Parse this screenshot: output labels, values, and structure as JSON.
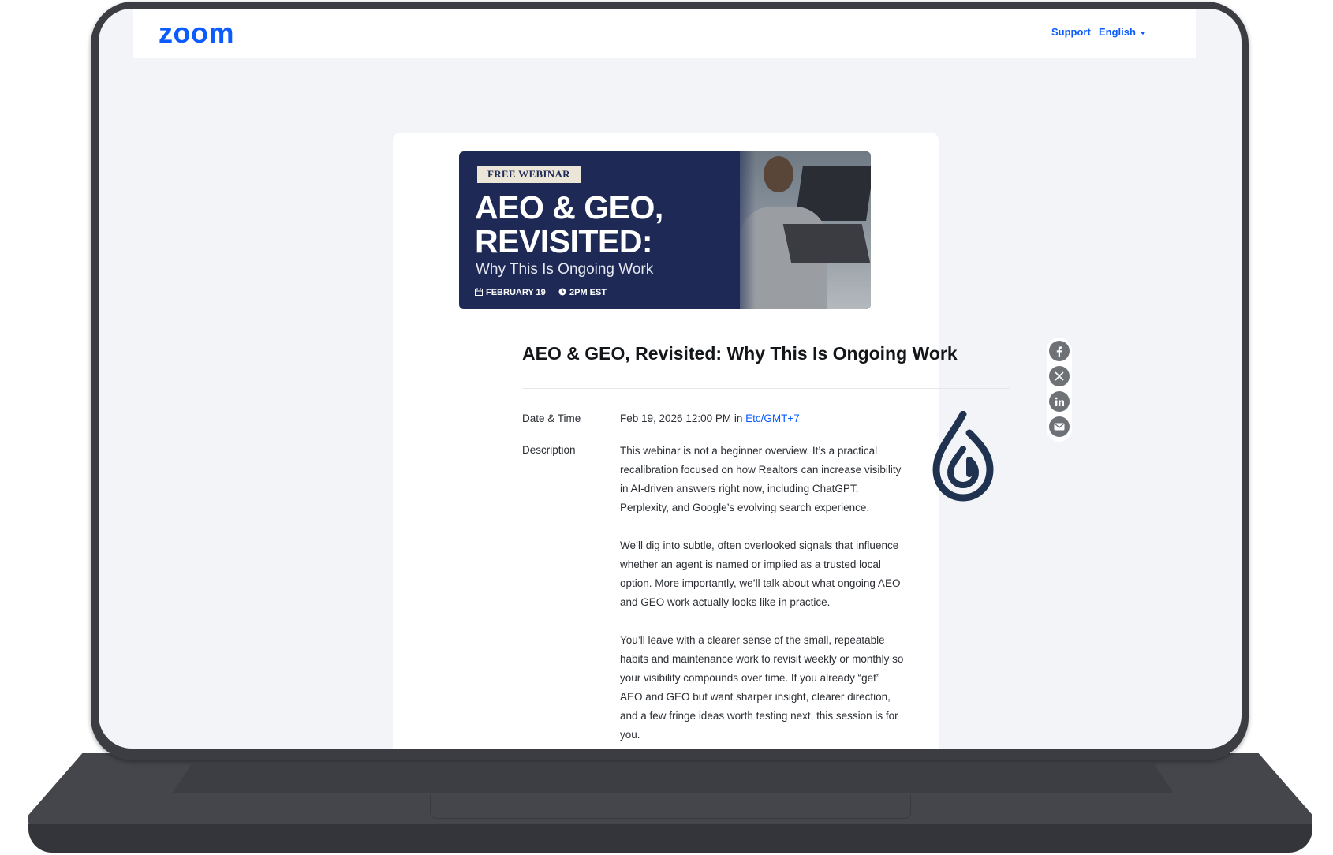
{
  "header": {
    "logo_text": "zoom",
    "support_label": "Support",
    "language_label": "English"
  },
  "banner": {
    "badge": "FREE WEBINAR",
    "title_line1": "AEO & GEO,",
    "title_line2": "REVISITED:",
    "subtitle": "Why This Is Ongoing Work",
    "date": "FEBRUARY 19",
    "time": "2PM EST"
  },
  "event": {
    "title": "AEO & GEO, Revisited: Why This Is Ongoing Work",
    "date_time_label": "Date & Time",
    "date_time_value": "Feb 19, 2026 12:00 PM in ",
    "timezone": "Etc/GMT+7",
    "description_label": "Description",
    "description": [
      "This webinar is not a beginner overview. It’s a practical recalibration focused on how Realtors can increase visibility in AI-driven answers right now, including ChatGPT, Perplexity, and Google’s evolving search experience.",
      "We’ll dig into subtle, often overlooked signals that influence whether an agent is named or implied as a trusted local option. More importantly, we’ll talk about what ongoing AEO and GEO work actually looks like in practice.",
      "You’ll leave with a clearer sense of the small, repeatable habits and maintenance work to revisit weekly or monthly so your visibility compounds over time. If you already “get” AEO and GEO but want sharper insight, clearer direction, and a few fringe ideas worth testing next, this session is for you."
    ]
  },
  "share": {
    "items": [
      "facebook-icon",
      "x-icon",
      "linkedin-icon",
      "email-icon"
    ]
  },
  "colors": {
    "brand_blue": "#0b5cff",
    "banner_navy": "#1e2a55",
    "logo_navy": "#1f3350",
    "device_gray": "#3c3d43"
  }
}
